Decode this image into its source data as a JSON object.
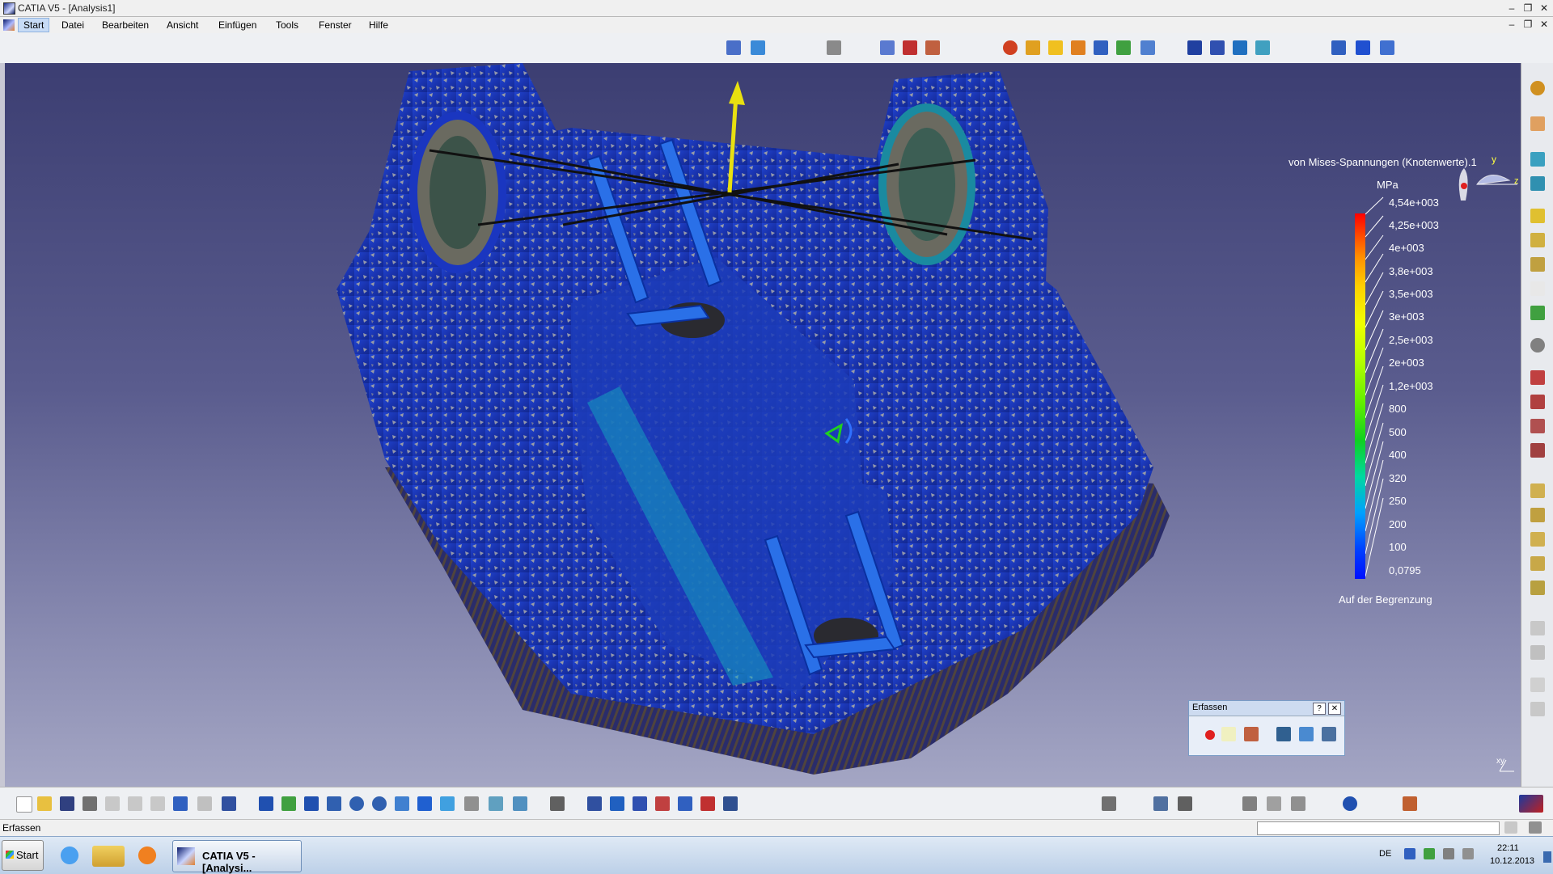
{
  "window": {
    "title": "CATIA V5 - [Analysis1]",
    "controls": {
      "minimize": "–",
      "maximize": "❐",
      "close": "✕"
    }
  },
  "menubar": {
    "items": [
      "Start",
      "Datei",
      "Bearbeiten",
      "Ansicht",
      "Einfügen",
      "Tools",
      "Fenster",
      "Hilfe"
    ]
  },
  "legend": {
    "title": "von Mises-Spannungen (Knotenwerte).1",
    "unit": "MPa",
    "values": [
      "4,54e+003",
      "4,25e+003",
      "4e+003",
      "3,8e+003",
      "3,5e+003",
      "3e+003",
      "2,5e+003",
      "2e+003",
      "1,2e+003",
      "800",
      "500",
      "400",
      "320",
      "250",
      "200",
      "100",
      "0,0795"
    ],
    "note": "Auf der Begrenzung"
  },
  "compass": {
    "y_label": "y",
    "z_label": "z"
  },
  "axis_label": "xy",
  "erfassen_toolbar": {
    "title": "Erfassen",
    "help": "?",
    "close": "✕"
  },
  "statusbar": {
    "text": "Erfassen"
  },
  "taskbar": {
    "start_label": "Start",
    "task_label": "CATIA V5 - [Analysi...",
    "language": "DE",
    "time": "22:11",
    "date": "10.12.2013"
  },
  "colors": {
    "viewport_top": "#3c3e72",
    "viewport_bottom": "#a4a6c4",
    "part_blue": "#1f3fc0",
    "part_gray": "#9c9a86",
    "arrow": "#e8e010"
  }
}
